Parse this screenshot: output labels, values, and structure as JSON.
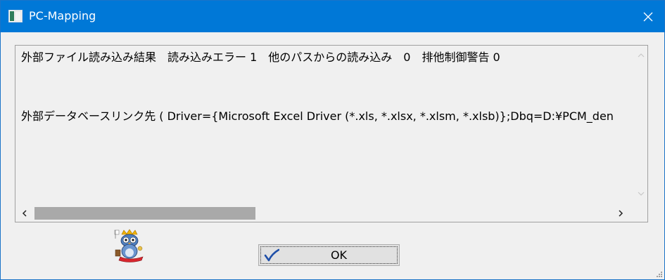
{
  "window": {
    "title": "PC-Mapping"
  },
  "log": {
    "lines": [
      "外部ファイル読み込み結果　読み込みエラー 1　他のパスからの読み込み　0　排他制御警告 0",
      "外部データベースリンク先 ( Driver={Microsoft Excel Driver (*.xls, *.xlsx, *.xlsm, *.xlsb)};Dbq=D:¥PCM_den"
    ]
  },
  "buttons": {
    "ok_label": "OK"
  },
  "icons": {
    "app": "window-icon",
    "close": "close-icon",
    "ok": "checkmark-icon",
    "mascot": "owl-mascot-icon"
  },
  "colors": {
    "titlebar": "#0078d7",
    "checkmark": "#1f4fa8"
  }
}
